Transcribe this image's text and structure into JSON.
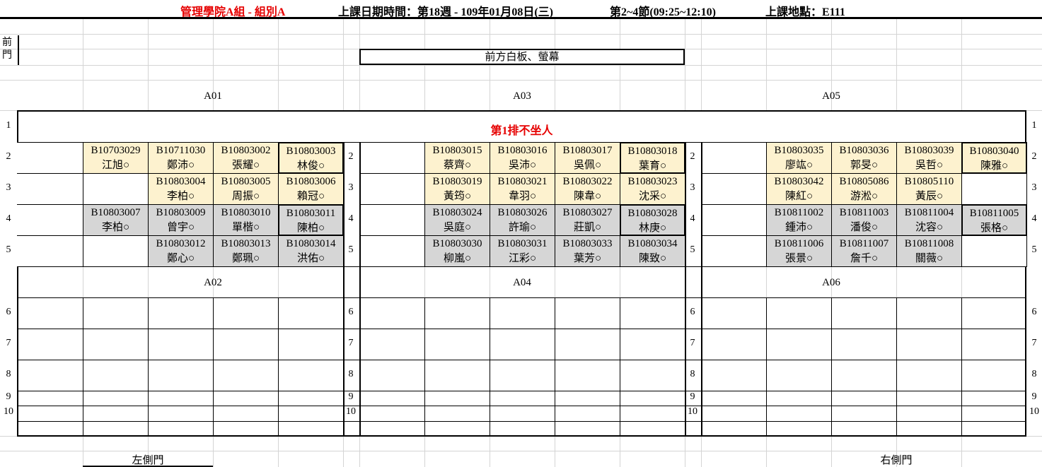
{
  "header": {
    "college": "管理學院A組 - 組別A",
    "datetime": "上課日期時間：第18週 - 109年01月08日(三)",
    "periods": "第2~4節(09:25~12:10)",
    "location": "上課地點：E111"
  },
  "room": {
    "front_door": "前門",
    "whiteboard": "前方白板、螢幕",
    "left_door": "左側門",
    "right_door": "右側門",
    "row1_note": "第1排不坐人"
  },
  "blocks": {
    "top": [
      "A01",
      "A03",
      "A05"
    ],
    "bottom": [
      "A02",
      "A04",
      "A06"
    ]
  },
  "row_numbers": [
    "1",
    "2",
    "3",
    "4",
    "5",
    "6",
    "7",
    "8",
    "9",
    "10"
  ],
  "colors": {
    "yellow": "#fdf2cf",
    "gray": "#d6d6d6",
    "accent_red": "#e60000"
  },
  "seats": {
    "left": {
      "r2": [
        {
          "id": "B10703029",
          "name": "江旭○",
          "color": "yellow"
        },
        {
          "id": "B10711030",
          "name": "鄭沛○",
          "color": "yellow"
        },
        {
          "id": "B10803002",
          "name": "張耀○",
          "color": "yellow"
        },
        {
          "id": "B10803003",
          "name": "林俊○",
          "color": "yellow",
          "bold": true
        }
      ],
      "r3": [
        null,
        {
          "id": "B10803004",
          "name": "李柏○",
          "color": "yellow"
        },
        {
          "id": "B10803005",
          "name": "周振○",
          "color": "yellow"
        },
        {
          "id": "B10803006",
          "name": "賴冠○",
          "color": "yellow"
        }
      ],
      "r4": [
        {
          "id": "B10803007",
          "name": "李柏○",
          "color": "gray"
        },
        {
          "id": "B10803009",
          "name": "曾宇○",
          "color": "gray"
        },
        {
          "id": "B10803010",
          "name": "單楷○",
          "color": "gray"
        },
        {
          "id": "B10803011",
          "name": "陳柏○",
          "color": "gray",
          "bold": true
        }
      ],
      "r5": [
        null,
        {
          "id": "B10803012",
          "name": "鄭心○",
          "color": "gray"
        },
        {
          "id": "B10803013",
          "name": "鄭珮○",
          "color": "gray"
        },
        {
          "id": "B10803014",
          "name": "洪佑○",
          "color": "gray"
        }
      ]
    },
    "middle": {
      "r2": [
        null,
        {
          "id": "B10803015",
          "name": "蔡齊○",
          "color": "yellow"
        },
        {
          "id": "B10803016",
          "name": "吳沛○",
          "color": "yellow"
        },
        {
          "id": "B10803017",
          "name": "吳佩○",
          "color": "yellow"
        },
        {
          "id": "B10803018",
          "name": "葉育○",
          "color": "yellow",
          "bold": true
        }
      ],
      "r3": [
        null,
        {
          "id": "B10803019",
          "name": "黃筠○",
          "color": "yellow"
        },
        {
          "id": "B10803021",
          "name": "韋羽○",
          "color": "yellow"
        },
        {
          "id": "B10803022",
          "name": "陳韋○",
          "color": "yellow"
        },
        {
          "id": "B10803023",
          "name": "沈采○",
          "color": "yellow"
        }
      ],
      "r4": [
        null,
        {
          "id": "B10803024",
          "name": "吳庭○",
          "color": "gray"
        },
        {
          "id": "B10803026",
          "name": "許瑜○",
          "color": "gray"
        },
        {
          "id": "B10803027",
          "name": "莊凱○",
          "color": "gray"
        },
        {
          "id": "B10803028",
          "name": "林庚○",
          "color": "gray",
          "bold": true
        }
      ],
      "r5": [
        null,
        {
          "id": "B10803030",
          "name": "柳嵐○",
          "color": "gray"
        },
        {
          "id": "B10803031",
          "name": "江彩○",
          "color": "gray"
        },
        {
          "id": "B10803033",
          "name": "葉芳○",
          "color": "gray"
        },
        {
          "id": "B10803034",
          "name": "陳致○",
          "color": "gray"
        }
      ]
    },
    "right": {
      "r2": [
        {
          "id": "B10803035",
          "name": "廖竑○",
          "color": "yellow"
        },
        {
          "id": "B10803036",
          "name": "郭旻○",
          "color": "yellow"
        },
        {
          "id": "B10803039",
          "name": "吳哲○",
          "color": "yellow"
        },
        {
          "id": "B10803040",
          "name": "陳雅○",
          "color": "yellow",
          "bold": true
        }
      ],
      "r3": [
        {
          "id": "B10803042",
          "name": "陳紅○",
          "color": "yellow"
        },
        {
          "id": "B10805086",
          "name": "游淞○",
          "color": "yellow"
        },
        {
          "id": "B10805110",
          "name": "黃辰○",
          "color": "yellow"
        },
        null
      ],
      "r4": [
        {
          "id": "B10811002",
          "name": "鍾沛○",
          "color": "gray"
        },
        {
          "id": "B10811003",
          "name": "潘俊○",
          "color": "gray"
        },
        {
          "id": "B10811004",
          "name": "沈容○",
          "color": "gray"
        },
        {
          "id": "B10811005",
          "name": "張格○",
          "color": "gray",
          "bold": true
        }
      ],
      "r5": [
        {
          "id": "B10811006",
          "name": "張景○",
          "color": "gray"
        },
        {
          "id": "B10811007",
          "name": "詹千○",
          "color": "gray"
        },
        {
          "id": "B10811008",
          "name": "關薇○",
          "color": "gray"
        },
        null
      ]
    }
  }
}
